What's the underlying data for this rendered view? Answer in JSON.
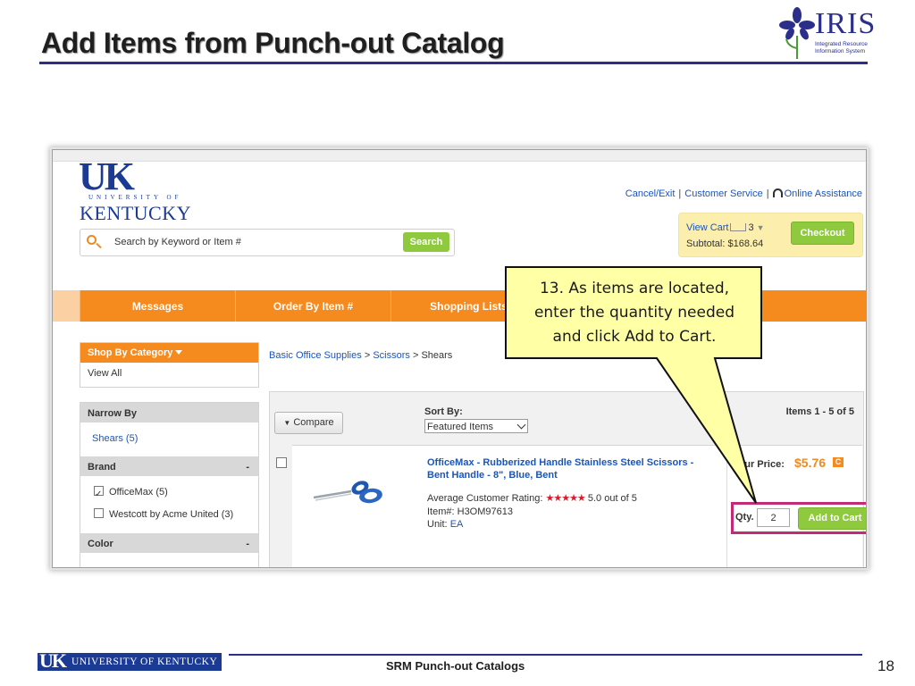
{
  "slide": {
    "title": "Add Items from Punch-out Catalog",
    "footer_text": "SRM Punch-out Catalogs",
    "page_number": "18",
    "footer_logo_uk": "UK",
    "footer_logo_text": "UNIVERSITY OF KENTUCKY"
  },
  "iris_logo": {
    "word": "IRIS",
    "subtitle_line1": "Integrated Resource",
    "subtitle_line2": "Information System"
  },
  "store": {
    "logo_big": "UK",
    "logo_univ": "UNIVERSITY OF",
    "logo_kentucky": "KENTUCKY",
    "top_links": {
      "cancel_exit": "Cancel/Exit",
      "customer_service": "Customer Service",
      "online_assistance": "Online Assistance"
    },
    "cart": {
      "view_cart": "View Cart",
      "count": "3",
      "subtotal_label": "Subtotal:",
      "subtotal_value": "$168.64",
      "checkout": "Checkout"
    },
    "search": {
      "placeholder": "Search by Keyword or Item #",
      "button": "Search"
    },
    "nav": [
      "Messages",
      "Order By Item #",
      "Shopping Lists"
    ],
    "shop_by_category": "Shop By Category",
    "view_all": "View All",
    "breadcrumb": {
      "level1": "Basic Office Supplies",
      "level2": "Scissors",
      "current": "Shears",
      "separator": ">"
    },
    "narrow_by": {
      "title": "Narrow By",
      "shears": "Shears (5)",
      "brand_title": "Brand",
      "brands": [
        "OfficeMax (5)",
        "Westcott by Acme United (3)"
      ],
      "color_title": "Color",
      "minus": "-"
    },
    "results": {
      "compare": "Compare",
      "sort_by_label": "Sort By:",
      "sort_value": "Featured Items",
      "items_count": "Items 1 - 5 of 5"
    },
    "product": {
      "brand": "OfficeMax",
      "title_rest": " - Rubberized Handle Stainless Steel Scissors -",
      "title_line2": "Bent Handle - 8\", Blue, Bent",
      "rating_label": "Average Customer Rating:",
      "stars": "★★★★★",
      "rating_value": "5.0 out of 5",
      "item_number": "Item#: H3OM97613",
      "unit_label": "Unit:",
      "unit_value": "EA",
      "your_price_label": "Your Price:",
      "price": "$5.76",
      "badge": "C",
      "qty_label": "Qty.",
      "qty_value": "2",
      "add_to_cart": "Add to Cart"
    }
  },
  "callout": {
    "line1": "13. As items are located,",
    "line2": "enter the quantity needed",
    "line3": "and click Add to Cart."
  },
  "colors": {
    "orange": "#f58a1f",
    "green_button": "#8fc93e",
    "link_blue": "#1b55b8",
    "highlight_magenta": "#c22a75",
    "callout_yellow": "#ffffa6",
    "title_rule_navy": "#2b2f8a"
  },
  "icons": [
    "iris-flower-icon",
    "headset-icon",
    "cart-icon",
    "search-icon",
    "scissors-icon",
    "caret-down-icon"
  ]
}
